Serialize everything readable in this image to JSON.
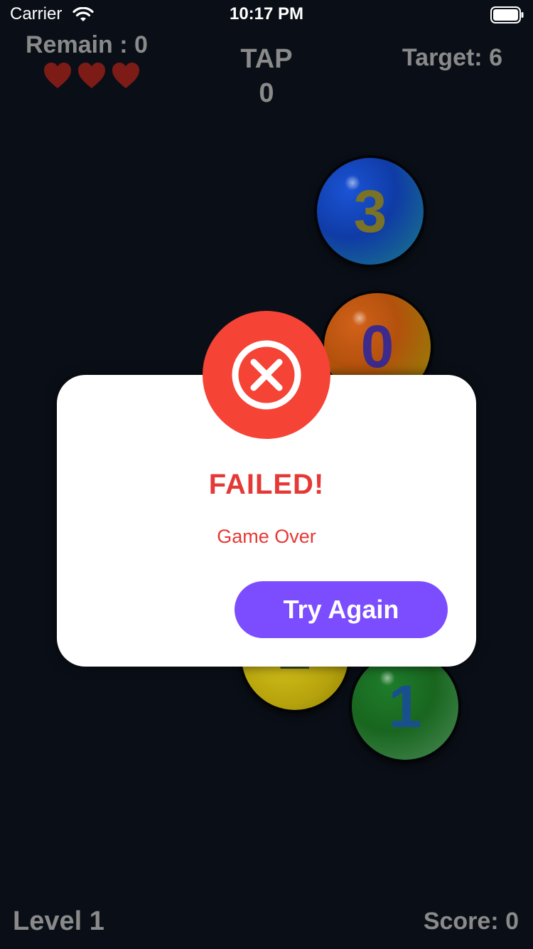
{
  "status_bar": {
    "carrier": "Carrier",
    "time": "10:17 PM",
    "wifi_icon": "wifi-icon",
    "battery_icon": "battery-icon"
  },
  "hud": {
    "remain": "Remain : 0",
    "hearts": [
      "heart-icon",
      "heart-icon",
      "heart-icon"
    ],
    "tap_title": "TAP",
    "tap_count": "0",
    "target": "Target: 6",
    "level": "Level 1",
    "score": "Score: 0"
  },
  "balls": [
    {
      "label": "3",
      "color": "#1b54d6"
    },
    {
      "label": "0",
      "color": "#b3510c"
    },
    {
      "label": "2",
      "color": "#b6a30d"
    },
    {
      "label": "1",
      "color": "#19661f"
    }
  ],
  "dialog": {
    "icon": "close-circle-icon",
    "title": "FAILED!",
    "subtitle": "Game Over",
    "button_label": "Try Again",
    "badge_color": "#f54336",
    "button_color": "#7b4dff"
  }
}
